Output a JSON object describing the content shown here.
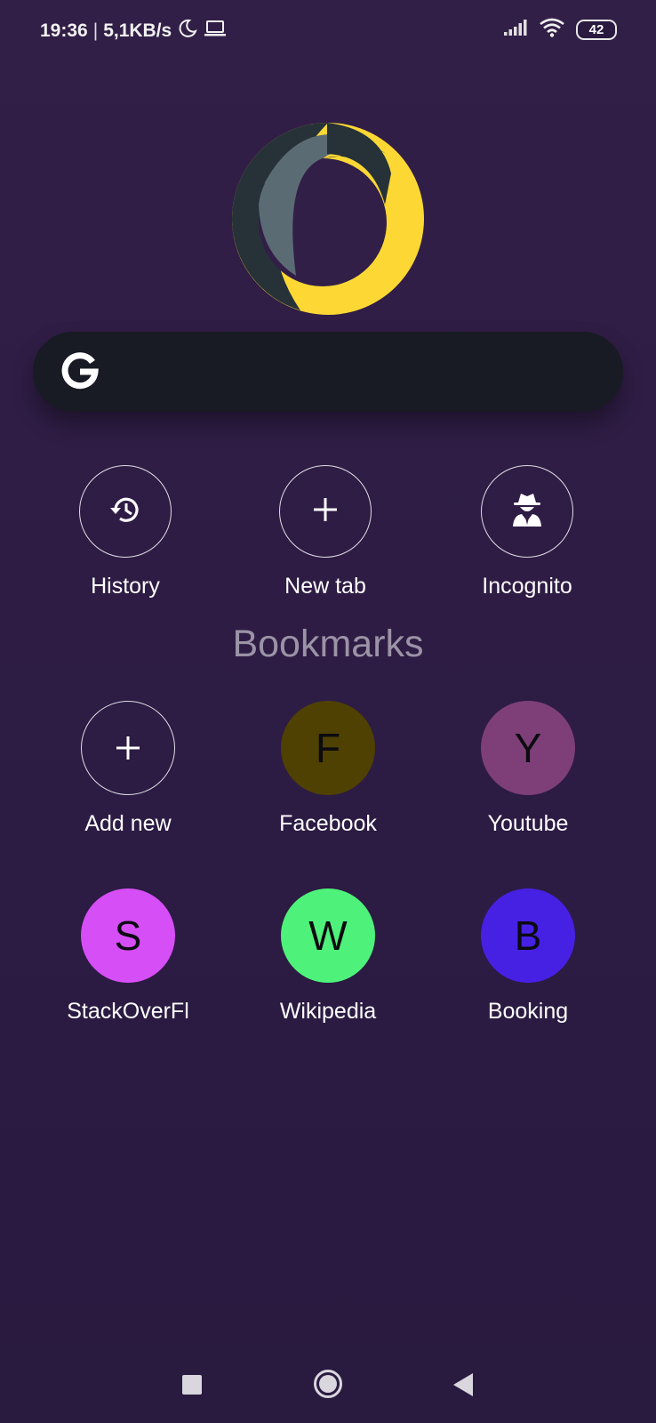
{
  "status_bar": {
    "time": "19:36",
    "separator": "|",
    "network_speed": "5,1KB/s",
    "icons": [
      "moon-icon",
      "laptop-icon",
      "signal-icon",
      "wifi-icon"
    ],
    "battery": "42"
  },
  "logo": {
    "icon": "browser-logo",
    "colors": {
      "yellow": "#fdd835",
      "slate": "#5b6b74",
      "dark": "#263238"
    }
  },
  "search": {
    "icon": "google-g-icon",
    "placeholder": ""
  },
  "quick_actions": [
    {
      "label": "History",
      "icon": "history-icon"
    },
    {
      "label": "New tab",
      "icon": "plus-icon"
    },
    {
      "label": "Incognito",
      "icon": "incognito-icon"
    }
  ],
  "bookmarks": {
    "title": "Bookmarks",
    "items": [
      {
        "label": "Add new",
        "letter": "+",
        "color": "transparent"
      },
      {
        "label": "Facebook",
        "letter": "F",
        "color": "#4f4102"
      },
      {
        "label": "Youtube",
        "letter": "Y",
        "color": "#7e3f78"
      },
      {
        "label": "StackOverFl",
        "letter": "S",
        "color": "#d64ef5"
      },
      {
        "label": "Wikipedia",
        "letter": "W",
        "color": "#4ef27a"
      },
      {
        "label": "Booking",
        "letter": "B",
        "color": "#4621e3"
      }
    ]
  },
  "nav_bar": {
    "icons": [
      "recents-icon",
      "home-icon",
      "back-icon"
    ]
  },
  "colors": {
    "background": "#2f1d45",
    "search_bg": "#181a24",
    "section_title": "#9b93a6"
  }
}
